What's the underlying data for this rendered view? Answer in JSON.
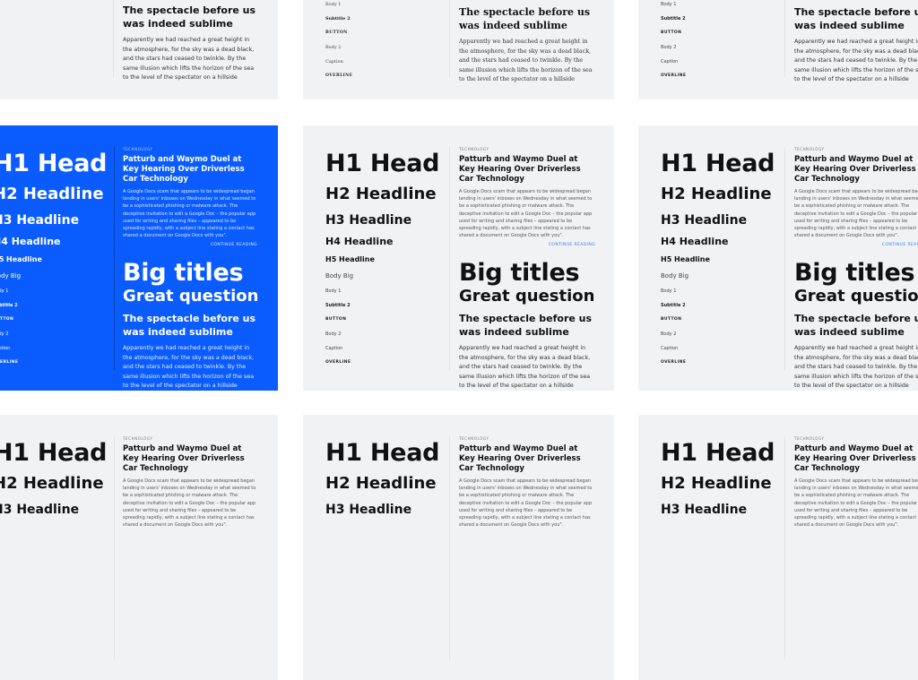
{
  "colors": {
    "page_bg": "#ffffff",
    "card_bg": "#f1f2f4",
    "accent_blue": "#0a5cff",
    "link_blue": "#3b7cf5"
  },
  "specimen": {
    "h1": "H1 Head",
    "h2": "H2 Headline",
    "h3": "H3 Headline",
    "h4": "H4 Headline",
    "h5": "H5 Headline",
    "body_big": "Body Big",
    "body_1": "Body 1",
    "subtitle_2": "Subtitle 2",
    "button": "BUTTON",
    "body_2": "Body 2",
    "caption": "Caption",
    "overline": "OVERLINE"
  },
  "article": {
    "category": "TECHNOLOGY",
    "title": "Patturb and Waymo Duel at Key Hearing Over Driverless Car Technology",
    "body": "A Google Docs scam that appears to be widespread began landing in users' inboxes on Wednesday in what seemed to be a sophisticated phishing or malware attack. The deceptive invitation to edit a Google Doc – the popular app used for writing and sharing files – appeared to be spreading rapidly, with a subject line stating a contact has shared a document on Google Docs with you\".",
    "continue_label": "CONTINUE READING"
  },
  "display": {
    "big_titles": "Big titles",
    "great_question": "Great question",
    "spectacle": "The spectacle before us was indeed sublime",
    "paragraph": "Apparently we had reached a great height in the atmosphere, for the sky was a dead black, and the stars had ceased to twinkle. By the same illusion which lifts the horizon of the sea to the level of the spectator on a hillside"
  },
  "cards": [
    {
      "id": "r1c1",
      "theme": "light",
      "font": "sans"
    },
    {
      "id": "r1c2",
      "theme": "light",
      "font": "serif"
    },
    {
      "id": "r1c3",
      "theme": "light",
      "font": "sans"
    },
    {
      "id": "r2c1",
      "theme": "blue",
      "font": "sans"
    },
    {
      "id": "r2c2",
      "theme": "light",
      "font": "sans"
    },
    {
      "id": "r2c3",
      "theme": "light",
      "font": "sans"
    },
    {
      "id": "r3c1",
      "theme": "light",
      "font": "sans"
    },
    {
      "id": "r3c2",
      "theme": "light",
      "font": "sans"
    },
    {
      "id": "r3c3",
      "theme": "light",
      "font": "sans"
    }
  ]
}
